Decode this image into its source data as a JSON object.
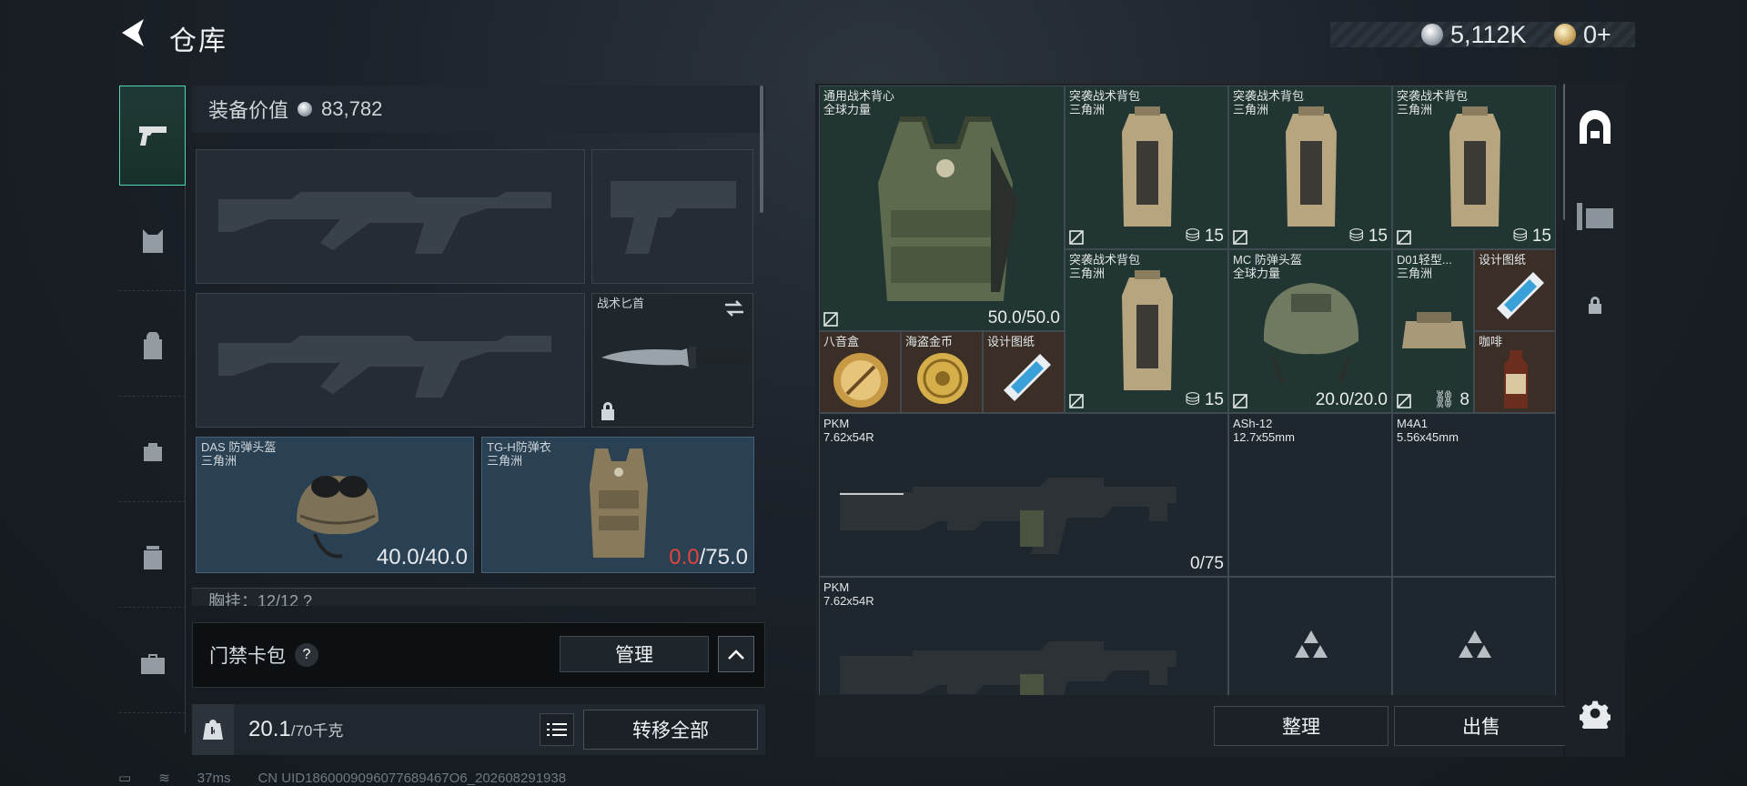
{
  "header": {
    "title": "仓库",
    "currency_silver": "5,112K",
    "currency_gold": "0+"
  },
  "left": {
    "equip_value_label": "装备价值",
    "equip_value": "83,782",
    "knife_label": "战术匕首",
    "helmet": {
      "name": "DAS 防弹头盔",
      "origin": "三角洲",
      "durability": "40.0/40.0"
    },
    "armor": {
      "name": "TG-H防弹衣",
      "origin": "三角洲",
      "durability_current": "0.0",
      "durability_max": "/75.0"
    },
    "chest_partial": "胸挂：12/12 ?",
    "card_pack_label": "门禁卡包",
    "card_pack_help": "?",
    "manage_label": "管理",
    "weight_value": "20.1",
    "weight_max": "/70千克",
    "transfer_all_label": "转移全部"
  },
  "grid": {
    "items": [
      {
        "name": "通用战术背心",
        "sub": "全球力量",
        "value": "50.0/50.0"
      },
      {
        "name": "突袭战术背包",
        "sub": "三角洲",
        "value": "15"
      },
      {
        "name": "突袭战术背包",
        "sub": "三角洲",
        "value": "15"
      },
      {
        "name": "突袭战术背包",
        "sub": "三角洲",
        "value": "15"
      },
      {
        "name": "突袭战术背包",
        "sub": "三角洲",
        "value": "15"
      },
      {
        "name": "MC 防弹头盔",
        "sub": "全球力量",
        "value": "20.0/20.0"
      },
      {
        "name": "D01轻型...",
        "sub": "三角洲",
        "value": "8"
      },
      {
        "name": "设计图纸",
        "sub": ""
      },
      {
        "name": "八音盒",
        "sub": ""
      },
      {
        "name": "海盗金币",
        "sub": ""
      },
      {
        "name": "设计图纸",
        "sub": ""
      },
      {
        "name": "咖啡",
        "sub": ""
      },
      {
        "name": "PKM",
        "sub": "7.62x54R",
        "value": "0/75"
      },
      {
        "name": "ASh-12",
        "sub": "12.7x55mm"
      },
      {
        "name": "M4A1",
        "sub": "5.56x45mm"
      },
      {
        "name": "PKM",
        "sub": "7.62x54R"
      }
    ],
    "sort_label": "整理",
    "sell_label": "出售"
  },
  "status": {
    "ping": "37ms",
    "uid": "CN UID1860009096077689467O6_202608291938"
  },
  "colors": {
    "accent": "#4fd6b7",
    "danger": "#e0443c",
    "green_cell": "#213532",
    "brown_cell": "#3a2e26"
  }
}
